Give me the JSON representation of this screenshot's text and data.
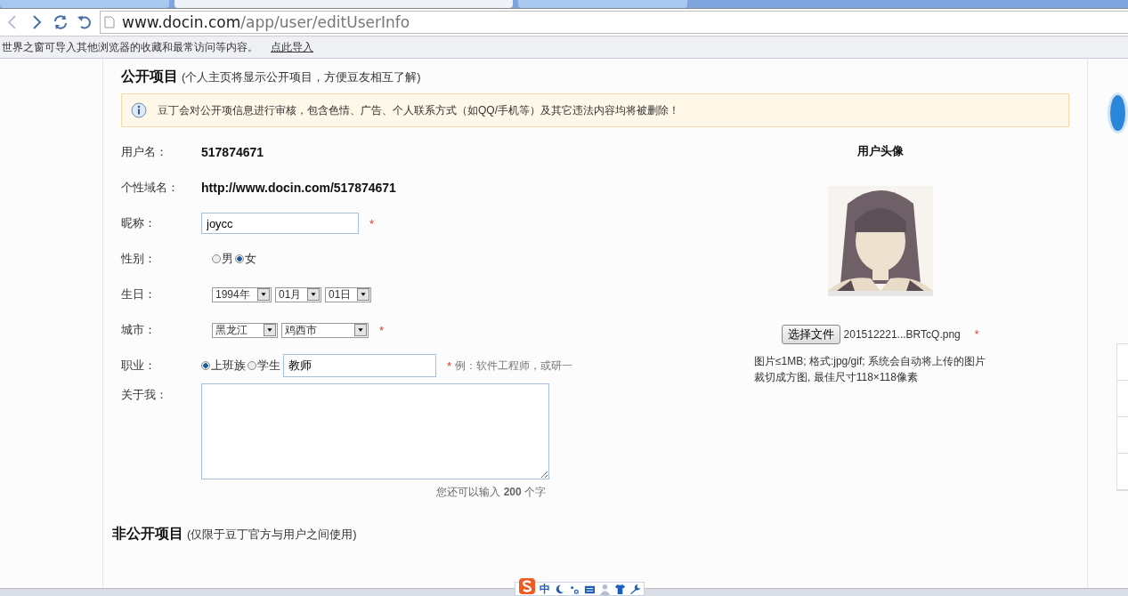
{
  "tabs": [
    {
      "selected": false
    },
    {
      "selected": true
    },
    {
      "selected": false
    }
  ],
  "browser": {
    "url_host": "www.docin.com",
    "url_path": "/app/user/editUserInfo",
    "infobar_text": "世界之窗可导入其他浏览器的收藏和最常访问等内容。",
    "infobar_link": "点此导入"
  },
  "public_section": {
    "title": "公开项目",
    "note": "(个人主页将显示公开项目，方便豆友相互了解)"
  },
  "notice": "豆丁会对公开项信息进行审核，包含色情、广告、个人联系方式（如QQ/手机等）及其它违法内容均将被删除！",
  "form_rows": [
    {
      "kind": "text",
      "label": "用户名：",
      "value": "517874671"
    },
    {
      "kind": "text",
      "label": "个性域名：",
      "value": "http://www.docin.com/517874671"
    },
    {
      "kind": "input",
      "label": "昵称：",
      "value": "joycc",
      "required_mark": "*"
    },
    {
      "kind": "radios",
      "label": "性别：",
      "options": [
        {
          "label": "男",
          "selected": false
        },
        {
          "label": "女",
          "selected": true
        }
      ]
    },
    {
      "kind": "selects",
      "label": "生日：",
      "selects": [
        "1994年",
        "01月",
        "01日"
      ]
    },
    {
      "kind": "selects",
      "label": "城市：",
      "selects": [
        "黑龙江",
        "鸡西市"
      ],
      "required_mark": "*"
    },
    {
      "kind": "occupation",
      "label": "职业：",
      "options": [
        {
          "label": "上班族",
          "selected": true
        },
        {
          "label": "学生",
          "selected": false
        }
      ],
      "value": "教师",
      "required_mark": "*",
      "hint": "例：软件工程师，或研一"
    },
    {
      "kind": "textarea",
      "label": "关于我："
    }
  ],
  "counter": "您还可以输入 **200** 个字",
  "avatar": {
    "title": "用户头像",
    "kind": "picture",
    "button": "选择文件",
    "filename": "201512221...BRTcQ.png",
    "required_mark": "*",
    "hint_lines": [
      "图片≤1MB; 格式:jpg/gif; 系统会自动将上传的图片",
      "裁切成方图, 最佳尺寸118×118像素"
    ]
  },
  "private_section": {
    "title": "非公开项目",
    "note": "(仅限于豆丁官方与用户之间使用)"
  },
  "ime": {
    "mode": "中"
  }
}
